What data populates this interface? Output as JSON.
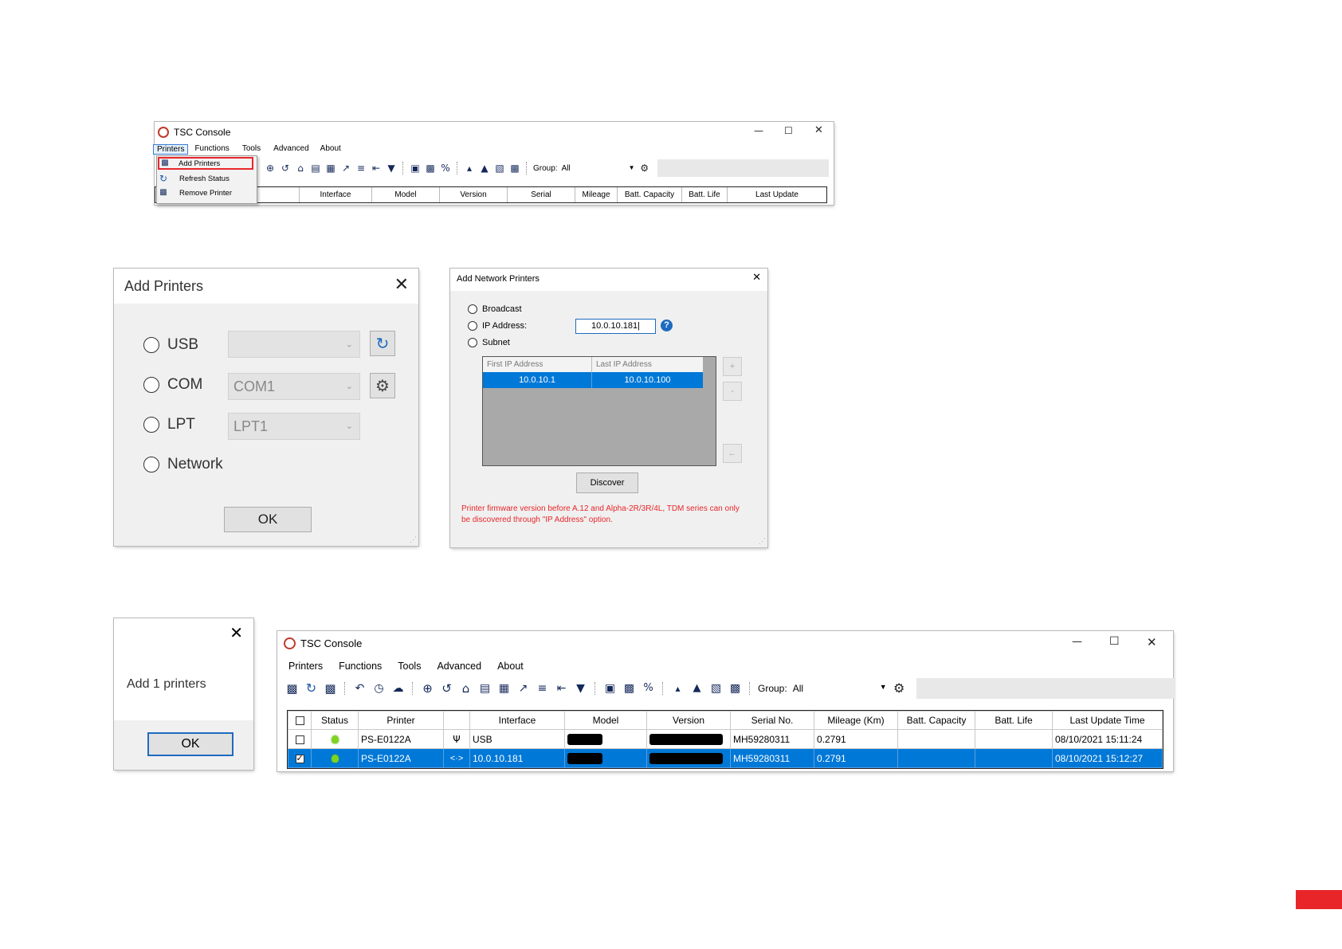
{
  "console_top": {
    "title": "TSC Console",
    "menu": [
      "Printers",
      "Functions",
      "Tools",
      "Advanced",
      "About"
    ],
    "dropdown": [
      "Add Printers",
      "Refresh Status",
      "Remove Printer"
    ],
    "group_label": "Group:",
    "group_value": "All",
    "columns": [
      "Interface",
      "Model",
      "Version",
      "Serial",
      "Mileage",
      "Batt. Capacity",
      "Batt. Life",
      "Last Update"
    ]
  },
  "add_printers": {
    "title": "Add Printers",
    "options": [
      "USB",
      "COM",
      "LPT",
      "Network"
    ],
    "com_value": "COM1",
    "lpt_value": "LPT1",
    "selected": "Network",
    "ok": "OK"
  },
  "add_network": {
    "title": "Add Network Printers",
    "radios": [
      "Broadcast",
      "IP Address:",
      "Subnet"
    ],
    "selected": "IP Address:",
    "ip_value": "10.0.10.181",
    "columns": [
      "First IP Address",
      "Last IP Address"
    ],
    "rows": [
      {
        "first": "10.0.10.1",
        "last": "10.0.10.100"
      }
    ],
    "side_buttons": [
      "+",
      "-",
      "←"
    ],
    "discover": "Discover",
    "note": "Printer firmware version before A.12 and Alpha-2R/3R/4L, TDM series can only be discovered through \"IP Address\" option.",
    "note_color": "#e8262a"
  },
  "confirm": {
    "message": "Add 1 printers",
    "ok": "OK"
  },
  "console_bottom": {
    "title": "TSC Console",
    "menu": [
      "Printers",
      "Functions",
      "Tools",
      "Advanced",
      "About"
    ],
    "group_label": "Group:",
    "group_value": "All",
    "columns": [
      "Status",
      "Printer",
      "Interface",
      "Model",
      "Version",
      "Serial No.",
      "Mileage (Km)",
      "Batt. Capacity",
      "Batt. Life",
      "Last Update Time"
    ],
    "rows": [
      {
        "checked": false,
        "printer": "PS-E0122A",
        "iface_icon": "usb-icon",
        "interface": "USB",
        "serial": "MH59280311",
        "mileage": "0.2791",
        "last_update": "08/10/2021 15:11:24",
        "selected": false
      },
      {
        "checked": true,
        "printer": "PS-E0122A",
        "iface_icon": "network-icon",
        "interface": "10.0.10.181",
        "serial": "MH59280311",
        "mileage": "0.2791",
        "last_update": "08/10/2021 15:12:27",
        "selected": true
      }
    ],
    "selection_color": "#0078d7"
  },
  "accent_color": "#e8262a"
}
